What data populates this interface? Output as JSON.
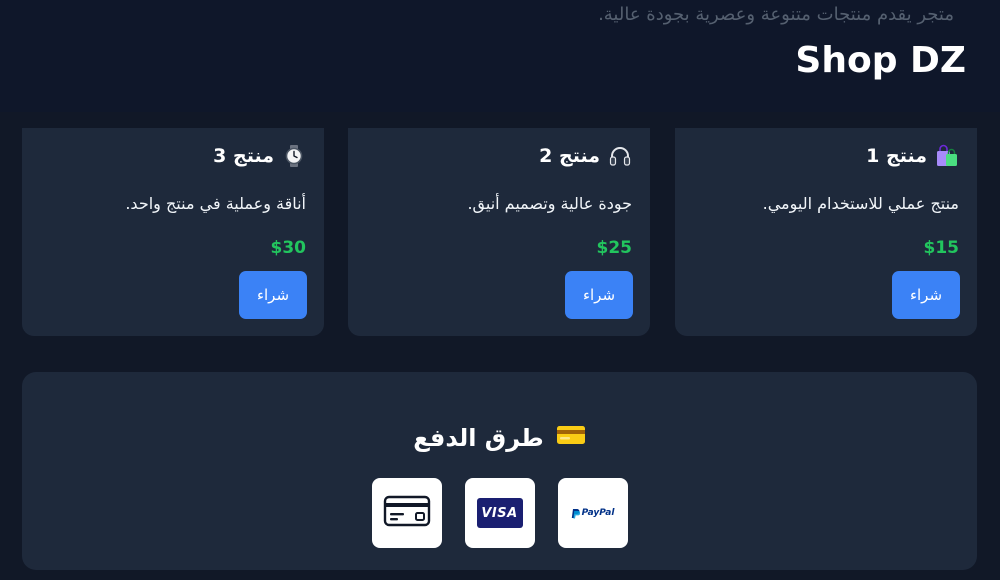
{
  "header": {
    "tagline": "متجر يقدم منتجات متنوعة وعصرية بجودة عالية.",
    "title": "Shop DZ"
  },
  "products": [
    {
      "name": "منتج 1",
      "icon": "shopping-bags-icon",
      "description": "منتج عملي للاستخدام اليومي.",
      "price": "$15",
      "buy_label": "شراء"
    },
    {
      "name": "منتج 2",
      "icon": "headphones-icon",
      "description": "جودة عالية وتصميم أنيق.",
      "price": "$25",
      "buy_label": "شراء"
    },
    {
      "name": "منتج 3",
      "icon": "watch-icon",
      "description": "أناقة وعملية في منتج واحد.",
      "price": "$30",
      "buy_label": "شراء"
    }
  ],
  "payment": {
    "title": "طرق الدفع",
    "title_icon": "credit-card-icon",
    "methods": [
      {
        "name": "paypal",
        "label": "PayPal"
      },
      {
        "name": "visa",
        "label": "VISA"
      },
      {
        "name": "card",
        "icon": "credit-card-outline-icon"
      }
    ]
  },
  "colors": {
    "background": "#111827",
    "card": "#1e293b",
    "accent": "#3b82f6",
    "price": "#22c55e"
  }
}
